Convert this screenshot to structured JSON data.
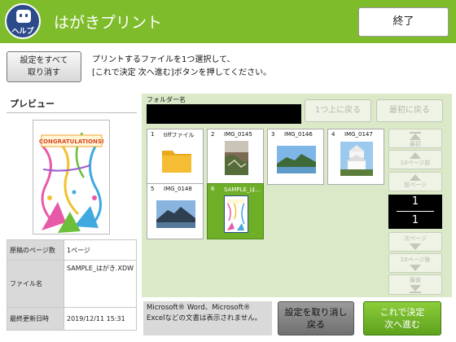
{
  "header": {
    "help_label": "ヘルプ",
    "title": "はがきプリント",
    "exit_label": "終了",
    "accent_color": "#7fbc2b"
  },
  "instruction": {
    "cancel_all_label_1": "設定をすべて",
    "cancel_all_label_2": "取り消す",
    "line1": "プリントするファイルを1つ選択して、",
    "line2": "[これで決定 次へ進む]ボタンを押してください。"
  },
  "preview": {
    "title": "プレビュー",
    "card_text": "CONGRATULATIONS!",
    "info": [
      {
        "label": "原稿のページ数",
        "value": "1ページ"
      },
      {
        "label": "ファイル名",
        "value": "SAMPLE_はがき.XDW"
      },
      {
        "label": "最終更新日時",
        "value": "2019/12/11 15:31"
      }
    ]
  },
  "browser": {
    "folder_label": "フォルダー名",
    "up_label": "1つ上に戻る",
    "first_label": "最初に戻る",
    "files": [
      {
        "num": "1",
        "name": "tiffファイル",
        "icon": "folder-icon"
      },
      {
        "num": "2",
        "name": "IMG_0145",
        "icon": "photo-thumbnail"
      },
      {
        "num": "3",
        "name": "IMG_0146",
        "icon": "photo-thumbnail"
      },
      {
        "num": "4",
        "name": "IMG_0147",
        "icon": "photo-thumbnail"
      },
      {
        "num": "5",
        "name": "IMG_0148",
        "icon": "photo-thumbnail"
      },
      {
        "num": "6",
        "name": "SAMPLE_は...",
        "icon": "postcard-thumbnail"
      }
    ],
    "nav": {
      "first": "最初",
      "prev10": "10ページ前",
      "prev": "前ページ",
      "current_page": "1",
      "total_pages": "1",
      "next": "次ページ",
      "next10": "10ページ後",
      "last": "最後"
    }
  },
  "footer": {
    "note": "Microsoft® Word、Microsoft® Excelなどの文書は表示されません。",
    "cancel_back_1": "設定を取り消し",
    "cancel_back_2": "戻る",
    "decide_1": "これで決定",
    "decide_2": "次へ進む"
  }
}
